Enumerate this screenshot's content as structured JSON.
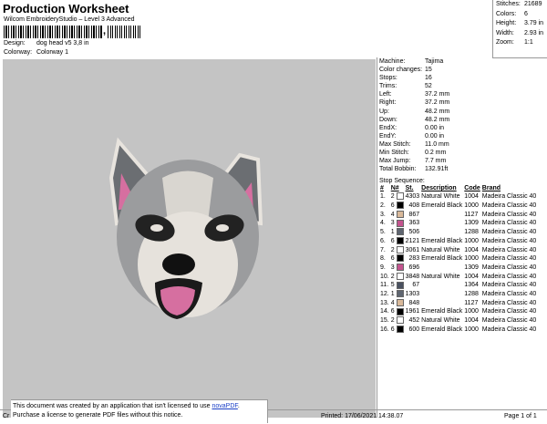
{
  "header": {
    "title": "Production Worksheet",
    "subtitle": "Wilcom EmbroideryStudio – Level 3 Advanced",
    "design_label": "Design:",
    "design_value": "dog head v5 3,8 in",
    "colorway_label": "Colorway:",
    "colorway_value": "Colorway 1"
  },
  "summary": [
    {
      "label": "Stitches:",
      "value": "21689"
    },
    {
      "label": "Colors:",
      "value": "6"
    },
    {
      "label": "Height:",
      "value": "3.79 in"
    },
    {
      "label": "Width:",
      "value": "2.93 in"
    },
    {
      "label": "Zoom:",
      "value": "1:1"
    }
  ],
  "params": [
    {
      "label": "Machine:",
      "value": "Tajima"
    },
    {
      "label": "Color changes:",
      "value": "15"
    },
    {
      "label": "Stops:",
      "value": "16"
    },
    {
      "label": "Trims:",
      "value": "52"
    },
    {
      "label": "Left:",
      "value": "37.2 mm"
    },
    {
      "label": "Right:",
      "value": "37.2 mm"
    },
    {
      "label": "Up:",
      "value": "48.2 mm"
    },
    {
      "label": "Down:",
      "value": "48.2 mm"
    },
    {
      "label": "EndX:",
      "value": "0.00 in"
    },
    {
      "label": "EndY:",
      "value": "0.00 in"
    },
    {
      "label": "Max Stitch:",
      "value": "11.0 mm"
    },
    {
      "label": "Min Stitch:",
      "value": "0.2 mm"
    },
    {
      "label": "Max Jump:",
      "value": "7.7 mm"
    },
    {
      "label": "Total Bobbin:",
      "value": "132.91ft"
    }
  ],
  "stop_sequence_title": "Stop Sequence:",
  "stop_columns": [
    "#",
    "N#",
    "St.",
    "Description",
    "Code",
    "Brand"
  ],
  "stops": [
    {
      "n": "1.",
      "needle": "2",
      "color": "#ffffff",
      "st": "4303",
      "desc": "Natural White",
      "code": "1004",
      "brand": "Madeira Classic 40"
    },
    {
      "n": "2.",
      "needle": "6",
      "color": "#000000",
      "st": "408",
      "desc": "Emerald Black",
      "code": "1000",
      "brand": "Madeira Classic 40"
    },
    {
      "n": "3.",
      "needle": "4",
      "color": "#d9b99a",
      "st": "867",
      "desc": "",
      "code": "1127",
      "brand": "Madeira Classic 40"
    },
    {
      "n": "4.",
      "needle": "3",
      "color": "#c4548f",
      "st": "363",
      "desc": "",
      "code": "1309",
      "brand": "Madeira Classic 40"
    },
    {
      "n": "5.",
      "needle": "1",
      "color": "#5e6570",
      "st": "506",
      "desc": "",
      "code": "1288",
      "brand": "Madeira Classic 40"
    },
    {
      "n": "6.",
      "needle": "6",
      "color": "#000000",
      "st": "2121",
      "desc": "Emerald Black",
      "code": "1000",
      "brand": "Madeira Classic 40"
    },
    {
      "n": "7.",
      "needle": "2",
      "color": "#ffffff",
      "st": "3061",
      "desc": "Natural White",
      "code": "1004",
      "brand": "Madeira Classic 40"
    },
    {
      "n": "8.",
      "needle": "6",
      "color": "#000000",
      "st": "283",
      "desc": "Emerald Black",
      "code": "1000",
      "brand": "Madeira Classic 40"
    },
    {
      "n": "9.",
      "needle": "3",
      "color": "#c4548f",
      "st": "696",
      "desc": "",
      "code": "1309",
      "brand": "Madeira Classic 40"
    },
    {
      "n": "10.",
      "needle": "2",
      "color": "#ffffff",
      "st": "3848",
      "desc": "Natural White",
      "code": "1004",
      "brand": "Madeira Classic 40"
    },
    {
      "n": "11.",
      "needle": "5",
      "color": "#4a5160",
      "st": "67",
      "desc": "",
      "code": "1364",
      "brand": "Madeira Classic 40"
    },
    {
      "n": "12.",
      "needle": "1",
      "color": "#5e6570",
      "st": "1303",
      "desc": "",
      "code": "1288",
      "brand": "Madeira Classic 40"
    },
    {
      "n": "13.",
      "needle": "4",
      "color": "#d9b99a",
      "st": "848",
      "desc": "",
      "code": "1127",
      "brand": "Madeira Classic 40"
    },
    {
      "n": "14.",
      "needle": "6",
      "color": "#000000",
      "st": "1961",
      "desc": "Emerald Black",
      "code": "1000",
      "brand": "Madeira Classic 40"
    },
    {
      "n": "15.",
      "needle": "2",
      "color": "#ffffff",
      "st": "452",
      "desc": "Natural White",
      "code": "1004",
      "brand": "Madeira Classic 40"
    },
    {
      "n": "16.",
      "needle": "6",
      "color": "#000000",
      "st": "600",
      "desc": "Emerald Black",
      "code": "1000",
      "brand": "Madeira Classic 40"
    }
  ],
  "notice": {
    "line1_prefix": "This document was created by an application that isn't licensed to use ",
    "link": "novaPDF",
    "line1_suffix": ".",
    "line2": "Purchase a license to generate PDF files without this notice."
  },
  "footer": {
    "left": "Cr",
    "printed": "Printed: 17/06/2021 14:38.07",
    "page": "Page 1 of 1"
  },
  "colors": {
    "canvas_bg": "#c4c4c4",
    "link": "#1a3fc7"
  }
}
